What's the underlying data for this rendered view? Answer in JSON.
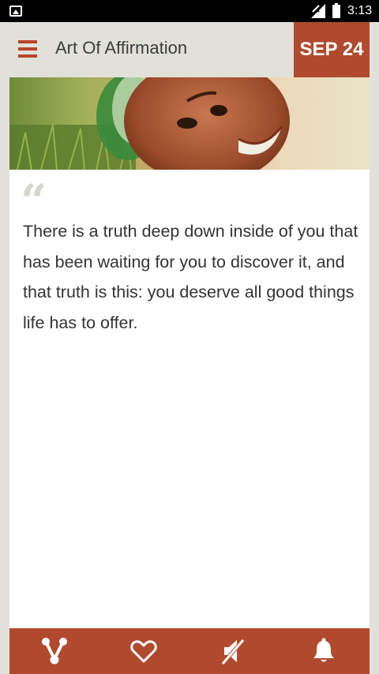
{
  "status_bar": {
    "time": "3:13"
  },
  "app_bar": {
    "title": "Art Of Affirmation",
    "date": "SEP 24"
  },
  "quote": {
    "mark": "“",
    "text": "There is a truth deep down inside of you that has been waiting for you to discover it, and that truth is this: you deserve all good things life has to offer."
  },
  "bottom_nav": {
    "icons": [
      "share-icon",
      "heart-icon",
      "sound-off-icon",
      "bell-icon"
    ]
  },
  "colors": {
    "accent": "#b04a2f",
    "background": "#e2e1d9",
    "text": "#333333"
  }
}
